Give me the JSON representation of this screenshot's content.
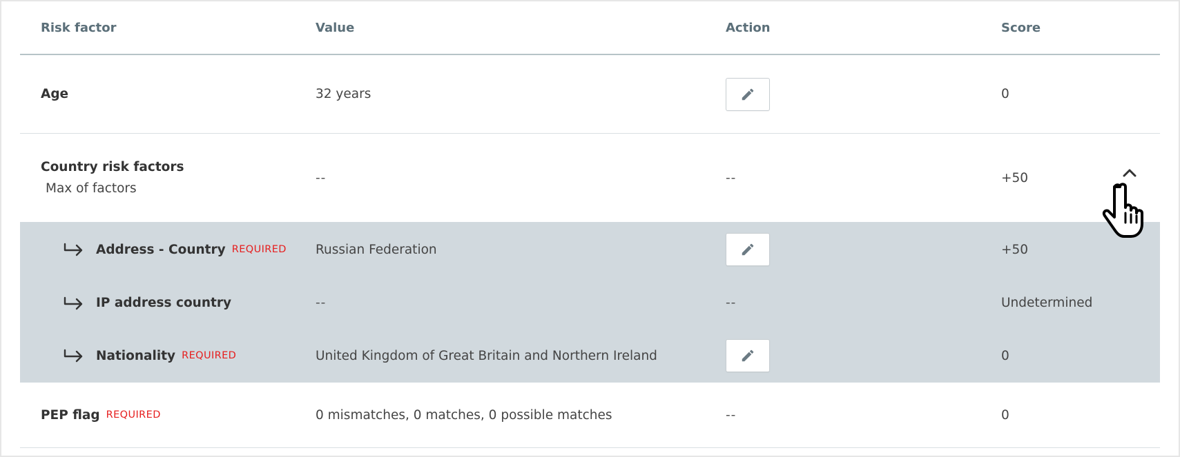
{
  "header": {
    "risk_factor": "Risk factor",
    "value": "Value",
    "action": "Action",
    "score": "Score"
  },
  "rows": {
    "age": {
      "label": "Age",
      "value": "32 years",
      "score": "0"
    },
    "country": {
      "label": "Country risk factors",
      "sublabel": "Max of factors",
      "value": "--",
      "action": "--",
      "score": "+50",
      "expanded": true
    },
    "address_country": {
      "label": "Address - Country",
      "required": "REQUIRED",
      "value": "Russian Federation",
      "score": "+50"
    },
    "ip_country": {
      "label": "IP address country",
      "value": "--",
      "action": "--",
      "score": "Undetermined"
    },
    "nationality": {
      "label": "Nationality",
      "required": "REQUIRED",
      "value": "United Kingdom of Great Britain and Northern Ireland",
      "score": "0"
    },
    "pep": {
      "label": "PEP flag",
      "required": "REQUIRED",
      "value": "0 mismatches, 0 matches, 0 possible matches",
      "action": "--",
      "score": "0"
    }
  },
  "icons": {
    "edit": "pencil-icon",
    "sub_arrow": "arrow-return-right-icon",
    "collapse": "chevron-up-icon",
    "cursor": "hand-pointer-cursor"
  },
  "colors": {
    "header_text": "#5b6f79",
    "expanded_bg": "#d1d9de",
    "required": "#e61e1e",
    "icon": "#6b7a83"
  }
}
